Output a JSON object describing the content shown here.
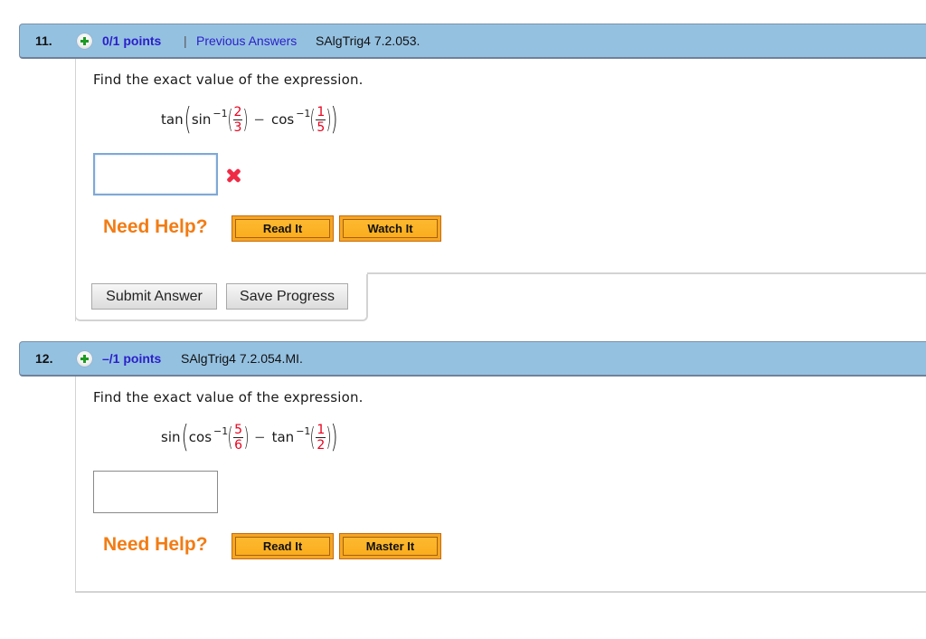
{
  "questions": [
    {
      "number": "11.",
      "points": "0/1 points",
      "separator": "|",
      "previous_answers_link": "Previous Answers",
      "code": "SAlgTrig4 7.2.053.",
      "prompt": "Find the exact value of the expression.",
      "expression": {
        "outer_fn": "tan",
        "inner_fn_1": "sin",
        "inner_fn_1_sup": "−1",
        "frac_1": {
          "num": "2",
          "den": "3"
        },
        "operator": "−",
        "inner_fn_2": "cos",
        "inner_fn_2_sup": "−1",
        "frac_2": {
          "num": "1",
          "den": "5"
        }
      },
      "answer_value": "",
      "status": "incorrect",
      "status_icon": "x-mark-icon",
      "need_help_label": "Need Help?",
      "help_buttons": [
        "Read It",
        "Watch It"
      ],
      "submit_label": "Submit Answer",
      "save_label": "Save Progress"
    },
    {
      "number": "12.",
      "points": "–/1 points",
      "code": "SAlgTrig4 7.2.054.MI.",
      "prompt": "Find the exact value of the expression.",
      "expression": {
        "outer_fn": "sin",
        "inner_fn_1": "cos",
        "inner_fn_1_sup": "−1",
        "frac_1": {
          "num": "5",
          "den": "6"
        },
        "operator": "−",
        "inner_fn_2": "tan",
        "inner_fn_2_sup": "−1",
        "frac_2": {
          "num": "1",
          "den": "2"
        }
      },
      "answer_value": "",
      "need_help_label": "Need Help?",
      "help_buttons": [
        "Read It",
        "Master It"
      ]
    }
  ],
  "colors": {
    "header_bg": "#95c1e1",
    "points_link": "#2a1fc9",
    "need_help": "#f27c14",
    "help_button": "#fbad1d",
    "fraction_digits": "#e8001c",
    "incorrect_mark": "#ef2a45"
  }
}
